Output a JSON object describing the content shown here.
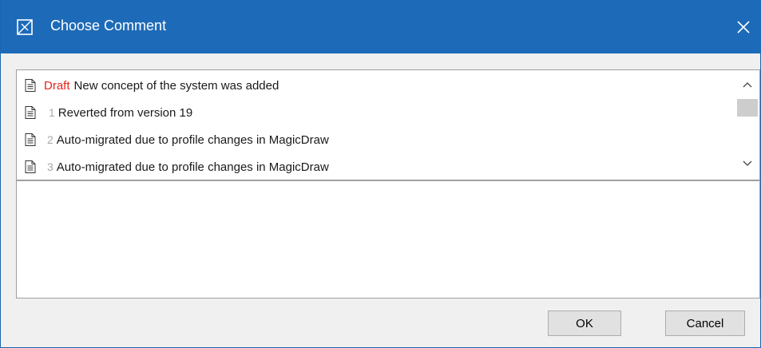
{
  "window": {
    "title": "Choose Comment",
    "title_icon": "comment-dialog-icon",
    "close_icon": "close-icon"
  },
  "colors": {
    "titlebar": "#1d6bb8",
    "draft": "#e5231b",
    "revision_number": "#a8a8a8"
  },
  "comments": [
    {
      "tag": "Draft",
      "number": "",
      "text": "New concept of the system was added",
      "icon": "document-icon"
    },
    {
      "tag": "",
      "number": "1",
      "text": "Reverted from version 19",
      "icon": "document-icon"
    },
    {
      "tag": "",
      "number": "2",
      "text": "Auto-migrated due to profile changes in MagicDraw",
      "icon": "document-icon"
    },
    {
      "tag": "",
      "number": "3",
      "text": "Auto-migrated due to profile changes in MagicDraw",
      "icon": "document-icon"
    }
  ],
  "comment_text": "",
  "buttons": {
    "ok": "OK",
    "cancel": "Cancel"
  }
}
